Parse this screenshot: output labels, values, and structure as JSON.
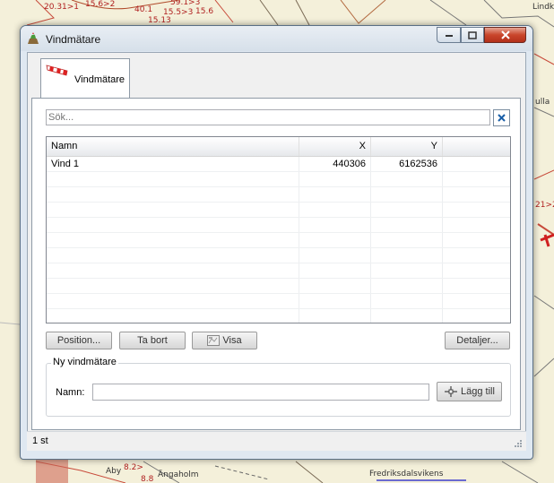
{
  "map": {
    "labels": [
      "20.31>1",
      "40.1",
      "15.5>3",
      "15.6",
      "15.13",
      "15.6>2",
      "59.1>3",
      "8.2>",
      "21>2",
      "8.8"
    ],
    "places": [
      "Lindk",
      "ulla",
      "Aby",
      "Ängaholm",
      "Fredriksdalsvikens"
    ]
  },
  "window": {
    "title": "Vindmätare",
    "icons": {
      "app": "windsock-pot-icon",
      "minimize": "minimize-icon",
      "maximize": "maximize-icon",
      "close": "close-icon"
    }
  },
  "tabs": [
    {
      "label": "Vindmätare",
      "icon": "windsock-icon",
      "selected": true
    }
  ],
  "search": {
    "placeholder": "Sök...",
    "value": "",
    "clear_icon": "clear-x-icon"
  },
  "grid": {
    "columns": [
      "Namn",
      "X",
      "Y",
      ""
    ],
    "rows": [
      {
        "name": "Vind 1",
        "x": "440306",
        "y": "6162536"
      }
    ],
    "empty_rows": 10
  },
  "buttons": {
    "position": "Position...",
    "remove": "Ta bort",
    "show": "Visa",
    "show_icon": "map-view-icon",
    "details": "Detaljer..."
  },
  "new_meter": {
    "group_title": "Ny vindmätare",
    "name_label": "Namn:",
    "name_value": "",
    "add_label": "Lägg till",
    "add_icon": "crosshair-add-icon"
  },
  "status": {
    "text": "1 st"
  }
}
